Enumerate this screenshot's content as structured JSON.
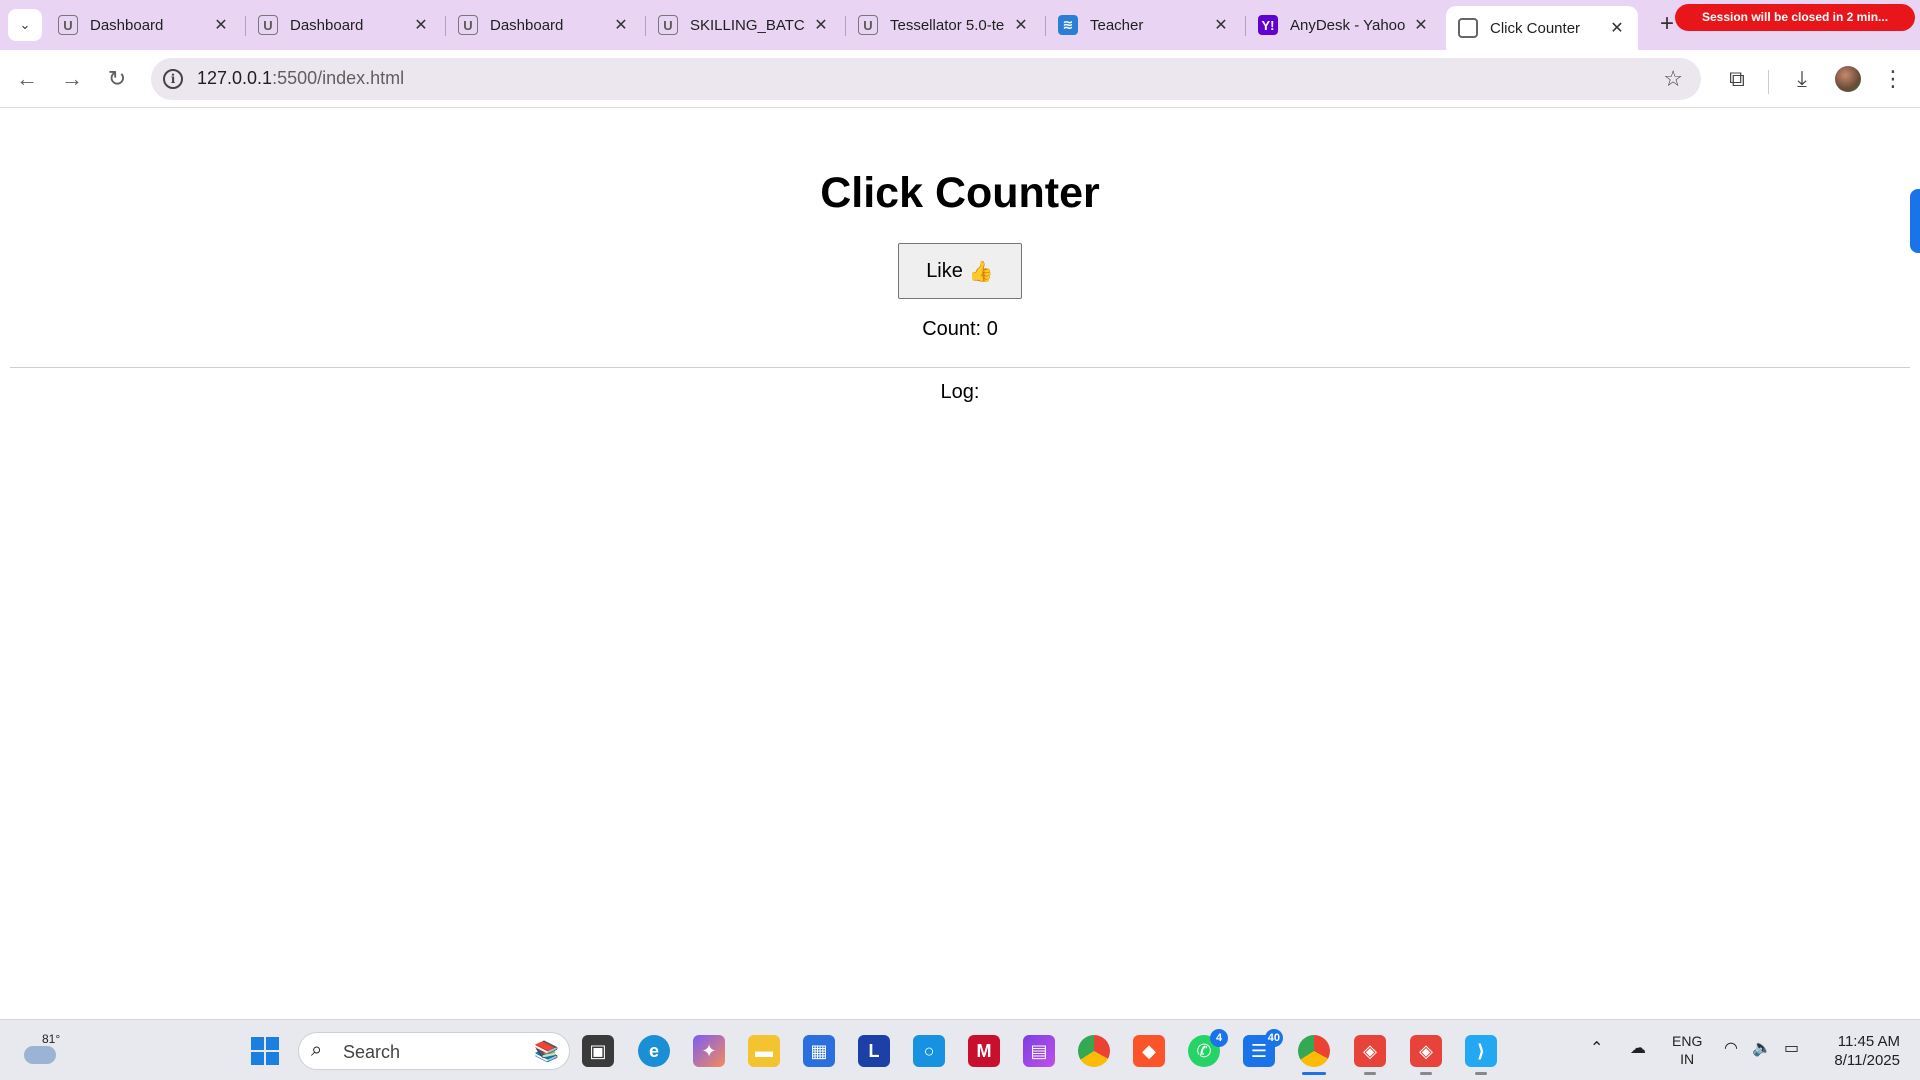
{
  "tabs": [
    {
      "title": "Dashboard",
      "favicon": "tu-icon"
    },
    {
      "title": "Dashboard",
      "favicon": "tu-icon"
    },
    {
      "title": "Dashboard",
      "favicon": "tu-icon"
    },
    {
      "title": "SKILLING_BATCH",
      "favicon": "tu-icon"
    },
    {
      "title": "Tessellator 5.0-te",
      "favicon": "tu-icon"
    },
    {
      "title": "Teacher",
      "favicon": "teacher-icon"
    },
    {
      "title": "AnyDesk - Yahoo",
      "favicon": "yahoo-icon"
    },
    {
      "title": "Click Counter",
      "favicon": "globe-icon",
      "active": true
    }
  ],
  "session_banner": "Session will be closed in 2 min...",
  "toolbar": {
    "url_host": "127.0.0.1",
    "url_rest": ":5500/index.html"
  },
  "page": {
    "title": "Click Counter",
    "like_label": "Like",
    "like_emoji": "👍",
    "count_label": "Count:",
    "count_value": "0",
    "log_label": "Log:"
  },
  "taskbar": {
    "weather_temp": "81°",
    "search_placeholder": "Search",
    "whatsapp_badge": "4",
    "people_badge": "40",
    "lang_line1": "ENG",
    "lang_line2": "IN",
    "time": "11:45 AM",
    "date": "8/11/2025"
  },
  "colors": {
    "tabstrip": "#e9d5f3",
    "session_banner": "#e8161a",
    "accent": "#1a73e8"
  }
}
